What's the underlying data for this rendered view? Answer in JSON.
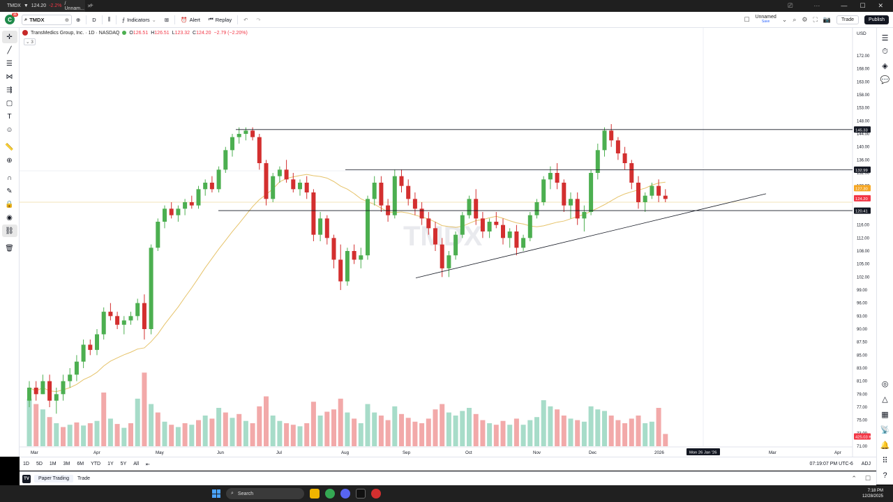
{
  "browser": {
    "tab_title": "TMDX",
    "tab_price": "124.20",
    "tab_change": "-2.2%",
    "tab_suffix": "/ Unnam..."
  },
  "toolbar": {
    "avatar_letter": "C",
    "avatar_badge": "11",
    "symbol": "TMDX",
    "interval": "D",
    "indicators_label": "Indicators",
    "alert_label": "Alert",
    "replay_label": "Replay",
    "layout_name": "Unnamed",
    "layout_status": "Save",
    "trade_label": "Trade",
    "publish_label": "Publish"
  },
  "legend": {
    "title": "TransMedics Group, Inc. · 1D · NASDAQ",
    "o_label": "O",
    "o_value": "126.51",
    "h_label": "H",
    "h_value": "126.51",
    "l_label": "L",
    "l_value": "123.32",
    "c_label": "C",
    "c_value": "124.20",
    "change": "−2.79 (−2.20%)",
    "indicator_count": "3"
  },
  "watermark": "TMDX",
  "chart_data": {
    "type": "candlestick",
    "symbol": "TMDX",
    "currency": "USD",
    "y_ticks": [
      "172.00",
      "168.00",
      "163.00",
      "158.00",
      "153.00",
      "148.00",
      "144.00",
      "140.00",
      "136.00",
      "132.00",
      "128.00",
      "124.00",
      "120.00",
      "116.00",
      "112.00",
      "108.00",
      "105.00",
      "102.00",
      "99.00",
      "96.00",
      "93.00",
      "90.00",
      "87.50",
      "85.00",
      "83.00",
      "81.00",
      "79.00",
      "77.00",
      "75.00",
      "73.00",
      "71.00"
    ],
    "x_labels": [
      "Mar",
      "Apr",
      "May",
      "Jun",
      "Jul",
      "Aug",
      "Sep",
      "Oct",
      "Nov",
      "Dec",
      "2026",
      "Mar 26 Jan '26",
      "Mar",
      "Apr"
    ],
    "x_label_values": [
      "Mar",
      "Apr",
      "May",
      "Jun",
      "Jul",
      "Aug",
      "Sep",
      "Oct",
      "Nov",
      "Dec",
      "2026",
      "Mon 26 Jan '26",
      "Mar",
      "Apr"
    ],
    "price_badges": [
      {
        "label": "145.33",
        "color": "#131722"
      },
      {
        "label": "132.99",
        "color": "#131722"
      },
      {
        "label": "127.30",
        "color": "#f5a623"
      },
      {
        "label": "124.20",
        "color": "#f23645"
      },
      {
        "label": "120.41",
        "color": "#131722"
      },
      {
        "label": "425.03 K",
        "color": "#f23645"
      }
    ],
    "horizontal_lines": [
      145.33,
      132.99,
      120.41
    ],
    "trendline": {
      "from": [
        101.8,
        "Sep"
      ],
      "to": [
        126.5,
        "Jan"
      ]
    },
    "up_color": "#4caf50",
    "down_color": "#d32f2f",
    "ma_color": "#e6c36a",
    "candles": [
      [
        0,
        78,
        81,
        77,
        80
      ],
      [
        1,
        80,
        81,
        78,
        79
      ],
      [
        2,
        79,
        82,
        79,
        81
      ],
      [
        3,
        81,
        82,
        77,
        78
      ],
      [
        4,
        78,
        80,
        76,
        79
      ],
      [
        5,
        79,
        82,
        78,
        81
      ],
      [
        6,
        81,
        83,
        80,
        82
      ],
      [
        7,
        82,
        85,
        81,
        84
      ],
      [
        8,
        84,
        88,
        83,
        87
      ],
      [
        9,
        87,
        88,
        85,
        86
      ],
      [
        10,
        86,
        90,
        85,
        89
      ],
      [
        11,
        89,
        95,
        88,
        94
      ],
      [
        12,
        94,
        96,
        92,
        93
      ],
      [
        13,
        93,
        94,
        90,
        91
      ],
      [
        14,
        91,
        93,
        89,
        92
      ],
      [
        15,
        92,
        94,
        91,
        93
      ],
      [
        16,
        93,
        97,
        92,
        96
      ],
      [
        17,
        96,
        98,
        88,
        90
      ],
      [
        18,
        90,
        110,
        89,
        109
      ],
      [
        19,
        109,
        118,
        108,
        117
      ],
      [
        20,
        117,
        122,
        115,
        121
      ],
      [
        21,
        121,
        123,
        118,
        119
      ],
      [
        22,
        119,
        122,
        117,
        121
      ],
      [
        23,
        121,
        124,
        119,
        123
      ],
      [
        24,
        123,
        125,
        121,
        122
      ],
      [
        25,
        122,
        128,
        121,
        127
      ],
      [
        26,
        127,
        130,
        125,
        129
      ],
      [
        27,
        129,
        131,
        126,
        127
      ],
      [
        28,
        127,
        134,
        126,
        133
      ],
      [
        29,
        133,
        140,
        132,
        139
      ],
      [
        30,
        139,
        144,
        137,
        143
      ],
      [
        31,
        143,
        146,
        141,
        144
      ],
      [
        32,
        144,
        146,
        142,
        145
      ],
      [
        33,
        145,
        146,
        142,
        143
      ],
      [
        34,
        143,
        144,
        133,
        135
      ],
      [
        35,
        135,
        136,
        122,
        124
      ],
      [
        36,
        124,
        132,
        123,
        131
      ],
      [
        37,
        131,
        134,
        129,
        133
      ],
      [
        38,
        133,
        136,
        129,
        130
      ],
      [
        39,
        130,
        132,
        126,
        127
      ],
      [
        40,
        127,
        130,
        125,
        129
      ],
      [
        41,
        129,
        131,
        124,
        126
      ],
      [
        42,
        126,
        127,
        111,
        113
      ],
      [
        43,
        113,
        120,
        111,
        118
      ],
      [
        44,
        118,
        119,
        110,
        112
      ],
      [
        45,
        112,
        113,
        104,
        106
      ],
      [
        46,
        106,
        110,
        99,
        101
      ],
      [
        47,
        101,
        109,
        100,
        108
      ],
      [
        48,
        108,
        110,
        105,
        106
      ],
      [
        49,
        106,
        109,
        104,
        107
      ],
      [
        50,
        107,
        125,
        106,
        124
      ],
      [
        51,
        124,
        131,
        122,
        129
      ],
      [
        52,
        129,
        131,
        120,
        122
      ],
      [
        53,
        122,
        124,
        117,
        119
      ],
      [
        54,
        119,
        133,
        118,
        131
      ],
      [
        55,
        131,
        133,
        126,
        128
      ],
      [
        56,
        128,
        130,
        122,
        124
      ],
      [
        57,
        124,
        126,
        119,
        121
      ],
      [
        58,
        121,
        123,
        116,
        118
      ],
      [
        59,
        118,
        120,
        113,
        115
      ],
      [
        60,
        115,
        117,
        108,
        110
      ],
      [
        61,
        110,
        112,
        102,
        104
      ],
      [
        62,
        104,
        108,
        102,
        107
      ],
      [
        63,
        107,
        114,
        106,
        113
      ],
      [
        64,
        113,
        120,
        112,
        119
      ],
      [
        65,
        119,
        125,
        118,
        124
      ],
      [
        66,
        124,
        127,
        116,
        118
      ],
      [
        67,
        118,
        120,
        112,
        114
      ],
      [
        68,
        114,
        118,
        112,
        117
      ],
      [
        69,
        117,
        120,
        115,
        116
      ],
      [
        70,
        116,
        118,
        110,
        112
      ],
      [
        71,
        112,
        115,
        109,
        114
      ],
      [
        72,
        114,
        116,
        107,
        109
      ],
      [
        73,
        109,
        113,
        108,
        112
      ],
      [
        74,
        112,
        120,
        111,
        119
      ],
      [
        75,
        119,
        124,
        118,
        123
      ],
      [
        76,
        123,
        131,
        122,
        130
      ],
      [
        77,
        130,
        134,
        127,
        132
      ],
      [
        78,
        132,
        135,
        127,
        129
      ],
      [
        79,
        129,
        130,
        120,
        122
      ],
      [
        80,
        122,
        126,
        118,
        124
      ],
      [
        81,
        124,
        126,
        116,
        118
      ],
      [
        82,
        118,
        122,
        114,
        120
      ],
      [
        83,
        120,
        133,
        119,
        132
      ],
      [
        84,
        132,
        141,
        130,
        139
      ],
      [
        85,
        139,
        146,
        137,
        145
      ],
      [
        86,
        145,
        147,
        140,
        142
      ],
      [
        87,
        142,
        143,
        136,
        138
      ],
      [
        88,
        138,
        140,
        133,
        135
      ],
      [
        89,
        135,
        136,
        127,
        129
      ],
      [
        90,
        129,
        131,
        121,
        123
      ],
      [
        91,
        123,
        126,
        120,
        125
      ],
      [
        92,
        125,
        129,
        124,
        128
      ],
      [
        93,
        128,
        130,
        123,
        125
      ],
      [
        94,
        125,
        127,
        123,
        124
      ]
    ],
    "volumes": [
      [
        0,
        0.62,
        1
      ],
      [
        1,
        0.55,
        0
      ],
      [
        2,
        0.48,
        1
      ],
      [
        3,
        0.38,
        0
      ],
      [
        4,
        0.3,
        1
      ],
      [
        5,
        0.25,
        0
      ],
      [
        6,
        0.28,
        1
      ],
      [
        7,
        0.31,
        0
      ],
      [
        8,
        0.27,
        1
      ],
      [
        9,
        0.3,
        0
      ],
      [
        10,
        0.33,
        1
      ],
      [
        11,
        0.7,
        0
      ],
      [
        12,
        0.36,
        1
      ],
      [
        13,
        0.29,
        0
      ],
      [
        14,
        0.24,
        1
      ],
      [
        15,
        0.3,
        0
      ],
      [
        16,
        0.62,
        1
      ],
      [
        17,
        0.96,
        0
      ],
      [
        18,
        0.55,
        1
      ],
      [
        19,
        0.44,
        0
      ],
      [
        20,
        0.32,
        1
      ],
      [
        21,
        0.28,
        0
      ],
      [
        22,
        0.25,
        1
      ],
      [
        23,
        0.3,
        0
      ],
      [
        24,
        0.28,
        1
      ],
      [
        25,
        0.34,
        0
      ],
      [
        26,
        0.4,
        1
      ],
      [
        27,
        0.36,
        0
      ],
      [
        28,
        0.5,
        1
      ],
      [
        29,
        0.44,
        0
      ],
      [
        30,
        0.37,
        1
      ],
      [
        31,
        0.42,
        0
      ],
      [
        32,
        0.33,
        1
      ],
      [
        33,
        0.3,
        0
      ],
      [
        34,
        0.52,
        0
      ],
      [
        35,
        0.65,
        0
      ],
      [
        36,
        0.4,
        1
      ],
      [
        37,
        0.33,
        1
      ],
      [
        38,
        0.3,
        0
      ],
      [
        39,
        0.28,
        0
      ],
      [
        40,
        0.26,
        1
      ],
      [
        41,
        0.3,
        0
      ],
      [
        42,
        0.58,
        0
      ],
      [
        43,
        0.4,
        1
      ],
      [
        44,
        0.45,
        0
      ],
      [
        45,
        0.48,
        0
      ],
      [
        46,
        0.62,
        0
      ],
      [
        47,
        0.44,
        1
      ],
      [
        48,
        0.36,
        0
      ],
      [
        49,
        0.3,
        1
      ],
      [
        50,
        0.55,
        1
      ],
      [
        51,
        0.44,
        1
      ],
      [
        52,
        0.4,
        0
      ],
      [
        53,
        0.34,
        0
      ],
      [
        54,
        0.52,
        1
      ],
      [
        55,
        0.42,
        0
      ],
      [
        56,
        0.37,
        0
      ],
      [
        57,
        0.32,
        0
      ],
      [
        58,
        0.3,
        0
      ],
      [
        59,
        0.36,
        0
      ],
      [
        60,
        0.48,
        0
      ],
      [
        61,
        0.55,
        0
      ],
      [
        62,
        0.44,
        1
      ],
      [
        63,
        0.4,
        1
      ],
      [
        64,
        0.46,
        1
      ],
      [
        65,
        0.5,
        1
      ],
      [
        66,
        0.42,
        0
      ],
      [
        67,
        0.34,
        0
      ],
      [
        68,
        0.3,
        1
      ],
      [
        69,
        0.28,
        0
      ],
      [
        70,
        0.33,
        0
      ],
      [
        71,
        0.28,
        1
      ],
      [
        72,
        0.36,
        0
      ],
      [
        73,
        0.28,
        1
      ],
      [
        74,
        0.34,
        1
      ],
      [
        75,
        0.38,
        1
      ],
      [
        76,
        0.6,
        1
      ],
      [
        77,
        0.52,
        1
      ],
      [
        78,
        0.48,
        0
      ],
      [
        79,
        0.4,
        0
      ],
      [
        80,
        0.36,
        1
      ],
      [
        81,
        0.34,
        0
      ],
      [
        82,
        0.32,
        1
      ],
      [
        83,
        0.52,
        1
      ],
      [
        84,
        0.48,
        1
      ],
      [
        85,
        0.46,
        1
      ],
      [
        86,
        0.4,
        0
      ],
      [
        87,
        0.34,
        0
      ],
      [
        88,
        0.3,
        0
      ],
      [
        89,
        0.36,
        0
      ],
      [
        90,
        0.4,
        0
      ],
      [
        91,
        0.3,
        1
      ],
      [
        92,
        0.32,
        1
      ],
      [
        93,
        0.5,
        0
      ],
      [
        94,
        0.16,
        0
      ]
    ]
  },
  "range_bar": {
    "ranges": [
      "1D",
      "5D",
      "1M",
      "3M",
      "6M",
      "YTD",
      "1Y",
      "5Y",
      "All"
    ],
    "time": "07:19:07 PM UTC-6",
    "adj": "ADJ"
  },
  "bottom_panel": {
    "tab1": "Paper Trading",
    "tab2": "Trade"
  },
  "taskbar": {
    "search_placeholder": "Search",
    "clock_time": "7:18 PM",
    "clock_date": "12/28/2025"
  }
}
